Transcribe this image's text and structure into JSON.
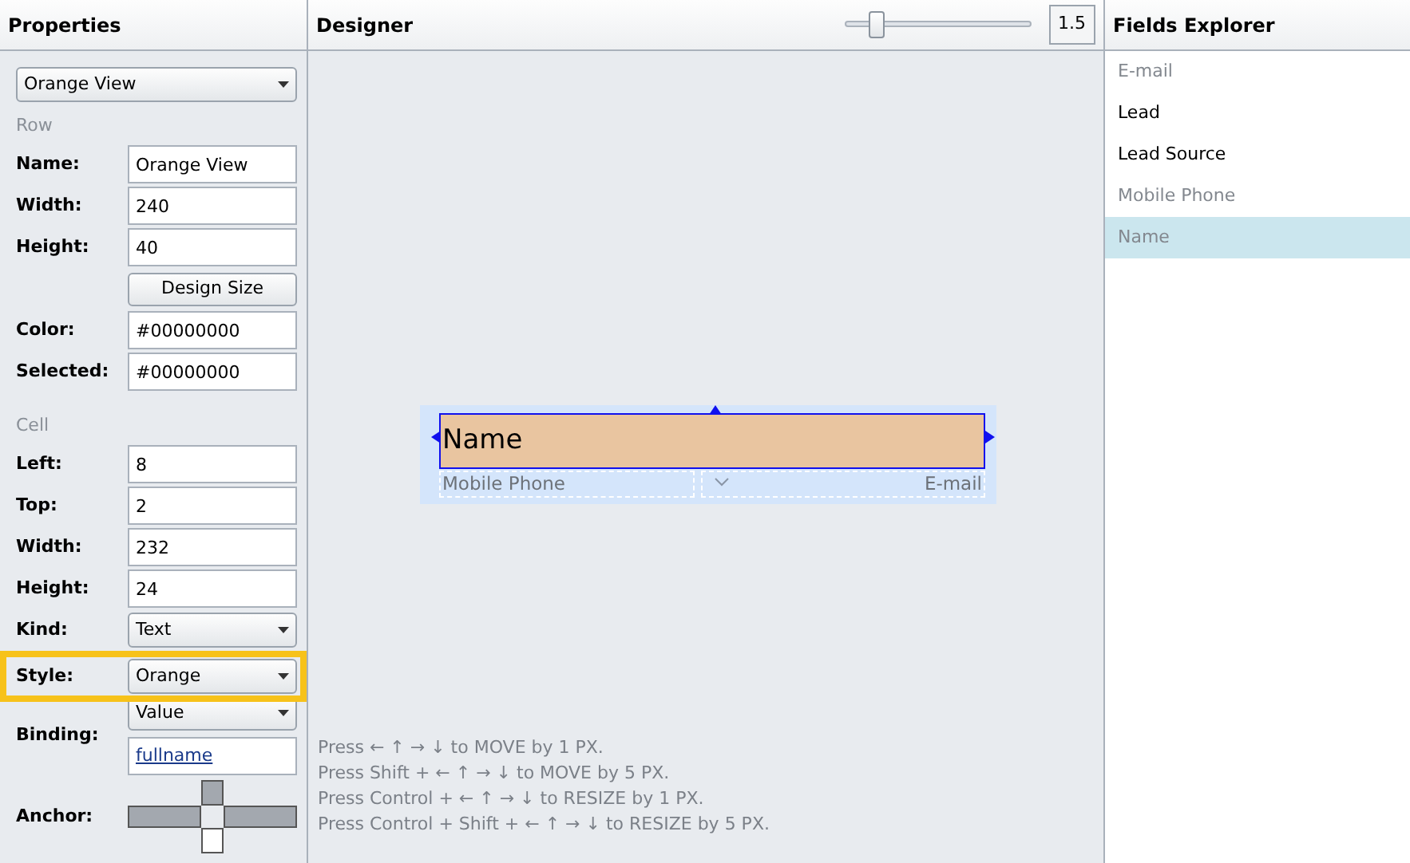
{
  "properties": {
    "title": "Properties",
    "items": [
      {
        "kind": "select",
        "value": "Orange View"
      },
      {
        "kind": "section",
        "label": "Row"
      },
      {
        "kind": "field",
        "label": "Name:",
        "value": "Orange View"
      },
      {
        "kind": "field",
        "label": "Width:",
        "value": "240"
      },
      {
        "kind": "field",
        "label": "Height:",
        "value": "40"
      },
      {
        "kind": "button",
        "label": "Design Size"
      },
      {
        "kind": "field",
        "label": "Color:",
        "value": "#00000000"
      },
      {
        "kind": "field",
        "label": "Selected:",
        "value": "#00000000"
      },
      {
        "kind": "section",
        "label": "Cell"
      },
      {
        "kind": "field",
        "label": "Left:",
        "value": "8"
      },
      {
        "kind": "field",
        "label": "Top:",
        "value": "2"
      },
      {
        "kind": "field",
        "label": "Width:",
        "value": "232"
      },
      {
        "kind": "field",
        "label": "Height:",
        "value": "24"
      },
      {
        "kind": "dropdown",
        "label": "Kind:",
        "value": "Text",
        "highlighted": false
      },
      {
        "kind": "dropdown",
        "label": "Style:",
        "value": "Orange",
        "highlighted": true
      },
      {
        "kind": "binding",
        "label": "Binding:",
        "value": "Value",
        "link": "fullname"
      },
      {
        "kind": "anchor",
        "label": "Anchor:",
        "anchor": {
          "top": true,
          "left": true,
          "right": true,
          "bottom": false
        }
      }
    ]
  },
  "designer": {
    "title": "Designer",
    "zoom": {
      "level": 0.17,
      "reading": "1.5"
    },
    "row": {
      "selected": true,
      "cells": [
        {
          "kind": "title",
          "text": "Name"
        },
        {
          "kind": "left",
          "text": "Mobile Phone"
        },
        {
          "kind": "right",
          "text": "E-mail"
        }
      ]
    },
    "hints": [
      "Press ← ↑ → ↓ to MOVE by 1 PX.",
      "Press Shift + ← ↑ → ↓ to MOVE by 5 PX.",
      "Press Control + ← ↑ → ↓ to RESIZE by 1 PX.",
      "Press Control + Shift + ← ↑ → ↓ to RESIZE by 5 PX."
    ]
  },
  "fields_explorer": {
    "title": "Fields Explorer",
    "items": [
      {
        "label": "E-mail",
        "used": true,
        "selected": false
      },
      {
        "label": "Lead",
        "used": false,
        "selected": false
      },
      {
        "label": "Lead Source",
        "used": false,
        "selected": false
      },
      {
        "label": "Mobile Phone",
        "used": true,
        "selected": false
      },
      {
        "label": "Name",
        "used": true,
        "selected": true
      }
    ]
  }
}
